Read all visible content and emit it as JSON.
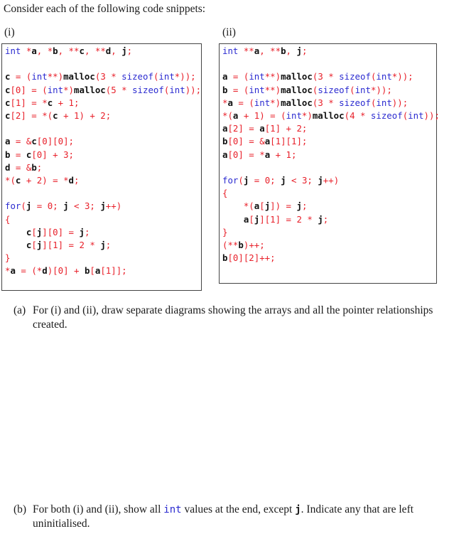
{
  "intro": "Consider each of the following code snippets:",
  "snippets": [
    {
      "label": "(i)",
      "lines": [
        [
          [
            "kw",
            "int "
          ],
          [
            "op",
            "*"
          ],
          [
            "id",
            "a"
          ],
          [
            "op",
            ", *"
          ],
          [
            "id",
            "b"
          ],
          [
            "op",
            ", **"
          ],
          [
            "id",
            "c"
          ],
          [
            "op",
            ", **"
          ],
          [
            "id",
            "d"
          ],
          [
            "op",
            ", "
          ],
          [
            "id",
            "j"
          ],
          [
            "op",
            ";"
          ]
        ],
        [],
        [
          [
            "id",
            "c"
          ],
          [
            "op",
            " = ("
          ],
          [
            "kw",
            "int"
          ],
          [
            "op",
            "**)"
          ],
          [
            "fn",
            "malloc"
          ],
          [
            "op",
            "(3 * "
          ],
          [
            "kw",
            "sizeof"
          ],
          [
            "op",
            "("
          ],
          [
            "kw",
            "int"
          ],
          [
            "op",
            "*));"
          ]
        ],
        [
          [
            "id",
            "c"
          ],
          [
            "op",
            "[0] = ("
          ],
          [
            "kw",
            "int"
          ],
          [
            "op",
            "*)"
          ],
          [
            "fn",
            "malloc"
          ],
          [
            "op",
            "(5 * "
          ],
          [
            "kw",
            "sizeof"
          ],
          [
            "op",
            "("
          ],
          [
            "kw",
            "int"
          ],
          [
            "op",
            "));"
          ]
        ],
        [
          [
            "id",
            "c"
          ],
          [
            "op",
            "[1] = *"
          ],
          [
            "id",
            "c"
          ],
          [
            "op",
            " + 1;"
          ]
        ],
        [
          [
            "id",
            "c"
          ],
          [
            "op",
            "[2] = *("
          ],
          [
            "id",
            "c"
          ],
          [
            "op",
            " + 1) + 2;"
          ]
        ],
        [],
        [
          [
            "id",
            "a"
          ],
          [
            "op",
            " = &"
          ],
          [
            "id",
            "c"
          ],
          [
            "op",
            "[0][0];"
          ]
        ],
        [
          [
            "id",
            "b"
          ],
          [
            "op",
            " = "
          ],
          [
            "id",
            "c"
          ],
          [
            "op",
            "[0] + 3;"
          ]
        ],
        [
          [
            "id",
            "d"
          ],
          [
            "op",
            " = &"
          ],
          [
            "id",
            "b"
          ],
          [
            "op",
            ";"
          ]
        ],
        [
          [
            "op",
            "*("
          ],
          [
            "id",
            "c"
          ],
          [
            "op",
            " + 2) = *"
          ],
          [
            "id",
            "d"
          ],
          [
            "op",
            ";"
          ]
        ],
        [],
        [
          [
            "kw",
            "for"
          ],
          [
            "op",
            "("
          ],
          [
            "id",
            "j"
          ],
          [
            "op",
            " = 0; "
          ],
          [
            "id",
            "j"
          ],
          [
            "op",
            " < 3; "
          ],
          [
            "id",
            "j"
          ],
          [
            "op",
            "++)"
          ]
        ],
        [
          [
            "op",
            "{"
          ]
        ],
        [
          [
            "op",
            "    "
          ],
          [
            "id",
            "c"
          ],
          [
            "op",
            "["
          ],
          [
            "id",
            "j"
          ],
          [
            "op",
            "][0] = "
          ],
          [
            "id",
            "j"
          ],
          [
            "op",
            ";"
          ]
        ],
        [
          [
            "op",
            "    "
          ],
          [
            "id",
            "c"
          ],
          [
            "op",
            "["
          ],
          [
            "id",
            "j"
          ],
          [
            "op",
            "][1] = 2 * "
          ],
          [
            "id",
            "j"
          ],
          [
            "op",
            ";"
          ]
        ],
        [
          [
            "op",
            "}"
          ]
        ],
        [
          [
            "op",
            "*"
          ],
          [
            "id",
            "a"
          ],
          [
            "op",
            " = (*"
          ],
          [
            "id",
            "d"
          ],
          [
            "op",
            ")[0] + "
          ],
          [
            "id",
            "b"
          ],
          [
            "op",
            "["
          ],
          [
            "id",
            "a"
          ],
          [
            "op",
            "[1]];"
          ]
        ]
      ]
    },
    {
      "label": "(ii)",
      "lines": [
        [
          [
            "kw",
            "int "
          ],
          [
            "op",
            "**"
          ],
          [
            "id",
            "a"
          ],
          [
            "op",
            ", **"
          ],
          [
            "id",
            "b"
          ],
          [
            "op",
            ", "
          ],
          [
            "id",
            "j"
          ],
          [
            "op",
            ";"
          ]
        ],
        [],
        [
          [
            "id",
            "a"
          ],
          [
            "op",
            " = ("
          ],
          [
            "kw",
            "int"
          ],
          [
            "op",
            "**)"
          ],
          [
            "fn",
            "malloc"
          ],
          [
            "op",
            "(3 * "
          ],
          [
            "kw",
            "sizeof"
          ],
          [
            "op",
            "("
          ],
          [
            "kw",
            "int"
          ],
          [
            "op",
            "*));"
          ]
        ],
        [
          [
            "id",
            "b"
          ],
          [
            "op",
            " = ("
          ],
          [
            "kw",
            "int"
          ],
          [
            "op",
            "**)"
          ],
          [
            "fn",
            "malloc"
          ],
          [
            "op",
            "("
          ],
          [
            "kw",
            "sizeof"
          ],
          [
            "op",
            "("
          ],
          [
            "kw",
            "int"
          ],
          [
            "op",
            "*));"
          ]
        ],
        [
          [
            "op",
            "*"
          ],
          [
            "id",
            "a"
          ],
          [
            "op",
            " = ("
          ],
          [
            "kw",
            "int"
          ],
          [
            "op",
            "*)"
          ],
          [
            "fn",
            "malloc"
          ],
          [
            "op",
            "(3 * "
          ],
          [
            "kw",
            "sizeof"
          ],
          [
            "op",
            "("
          ],
          [
            "kw",
            "int"
          ],
          [
            "op",
            "));"
          ]
        ],
        [
          [
            "op",
            "*("
          ],
          [
            "id",
            "a"
          ],
          [
            "op",
            " + 1) = ("
          ],
          [
            "kw",
            "int"
          ],
          [
            "op",
            "*)"
          ],
          [
            "fn",
            "malloc"
          ],
          [
            "op",
            "(4 * "
          ],
          [
            "kw",
            "sizeof"
          ],
          [
            "op",
            "("
          ],
          [
            "kw",
            "int"
          ],
          [
            "op",
            "));"
          ]
        ],
        [
          [
            "id",
            "a"
          ],
          [
            "op",
            "[2] = "
          ],
          [
            "id",
            "a"
          ],
          [
            "op",
            "[1] + 2;"
          ]
        ],
        [
          [
            "id",
            "b"
          ],
          [
            "op",
            "[0] = &"
          ],
          [
            "id",
            "a"
          ],
          [
            "op",
            "[1][1];"
          ]
        ],
        [
          [
            "id",
            "a"
          ],
          [
            "op",
            "[0] = *"
          ],
          [
            "id",
            "a"
          ],
          [
            "op",
            " + 1;"
          ]
        ],
        [],
        [
          [
            "kw",
            "for"
          ],
          [
            "op",
            "("
          ],
          [
            "id",
            "j"
          ],
          [
            "op",
            " = 0; "
          ],
          [
            "id",
            "j"
          ],
          [
            "op",
            " < 3; "
          ],
          [
            "id",
            "j"
          ],
          [
            "op",
            "++)"
          ]
        ],
        [
          [
            "op",
            "{"
          ]
        ],
        [
          [
            "op",
            "    *("
          ],
          [
            "id",
            "a"
          ],
          [
            "op",
            "["
          ],
          [
            "id",
            "j"
          ],
          [
            "op",
            "]) = "
          ],
          [
            "id",
            "j"
          ],
          [
            "op",
            ";"
          ]
        ],
        [
          [
            "op",
            "    "
          ],
          [
            "id",
            "a"
          ],
          [
            "op",
            "["
          ],
          [
            "id",
            "j"
          ],
          [
            "op",
            "][1] = 2 * "
          ],
          [
            "id",
            "j"
          ],
          [
            "op",
            ";"
          ]
        ],
        [
          [
            "op",
            "}"
          ]
        ],
        [
          [
            "op",
            "(**"
          ],
          [
            "id",
            "b"
          ],
          [
            "op",
            ")++;"
          ]
        ],
        [
          [
            "id",
            "b"
          ],
          [
            "op",
            "[0][2]++;"
          ]
        ]
      ]
    }
  ],
  "questions": {
    "a": {
      "mark": "(a)",
      "text": "For (i) and (ii), draw separate diagrams showing the arrays and all the pointer relationships created."
    },
    "b": {
      "mark": "(b)",
      "text_before": "For both (i) and (ii), show all ",
      "kw": "int",
      "text_middle": " values at the end, except ",
      "var": "j",
      "text_after": ". Indicate any that are left uninitialised."
    }
  }
}
